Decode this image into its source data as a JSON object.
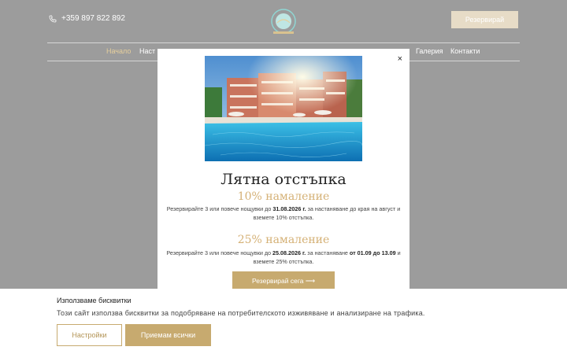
{
  "header": {
    "phone": "+359 897 822 892",
    "reserve_label": "Резервирай",
    "nav": [
      "Начало",
      "Наст",
      "Галерия",
      "Контакти"
    ]
  },
  "popup": {
    "close_label": "×",
    "title": "Лятна отстъпка",
    "offer1": {
      "heading": "10% намаление",
      "text_a": "Резервирайте 3 или повече нощувки до ",
      "date": "31.08.2026 г.",
      "text_b": " за настаняване до края на август и вземете 10% отстъпка."
    },
    "offer2": {
      "heading": "25% намаление",
      "text_a": "Резервирайте 3 или повече нощувки до ",
      "date": "25.08.2026 г.",
      "text_b": " за настаняване ",
      "period": "от 01.09 до 13.09",
      "text_c": " и вземете 25% отстъпка."
    },
    "cta_label": "Резервирай сега ⟶"
  },
  "cookies": {
    "title": "Използваме бисквитки",
    "text": "Този сайт използва бисквитки за подобряване на потребителското изживяване и анализиране на трафика.",
    "settings_label": "Настройки",
    "accept_label": "Приемам всички"
  },
  "colors": {
    "gold": "#c7aa6f",
    "gold_light": "#d5b176",
    "dim": "#9c9c9c"
  }
}
